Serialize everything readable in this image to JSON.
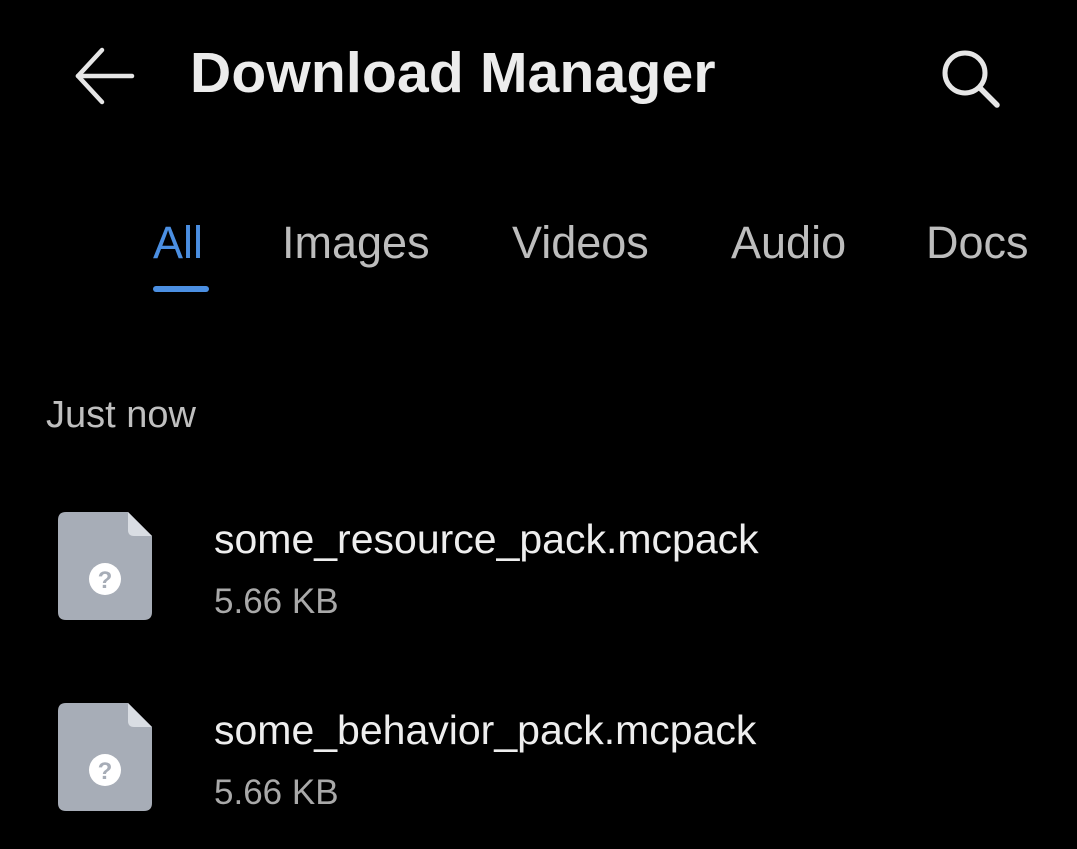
{
  "header": {
    "title": "Download Manager",
    "back_icon": "arrow-left-icon",
    "search_icon": "search-icon"
  },
  "tabs": [
    {
      "label": "All",
      "active": true
    },
    {
      "label": "Images",
      "active": false
    },
    {
      "label": "Videos",
      "active": false
    },
    {
      "label": "Audio",
      "active": false
    },
    {
      "label": "Docs",
      "active": false
    }
  ],
  "section": {
    "label": "Just now"
  },
  "files": [
    {
      "name": "some_resource_pack.mcpack",
      "size": "5.66 KB",
      "icon": "unknown-file-icon"
    },
    {
      "name": "some_behavior_pack.mcpack",
      "size": "5.66 KB",
      "icon": "unknown-file-icon"
    }
  ],
  "colors": {
    "background": "#000000",
    "accent": "#4b8fe2",
    "file_icon": "#a7adb7"
  }
}
